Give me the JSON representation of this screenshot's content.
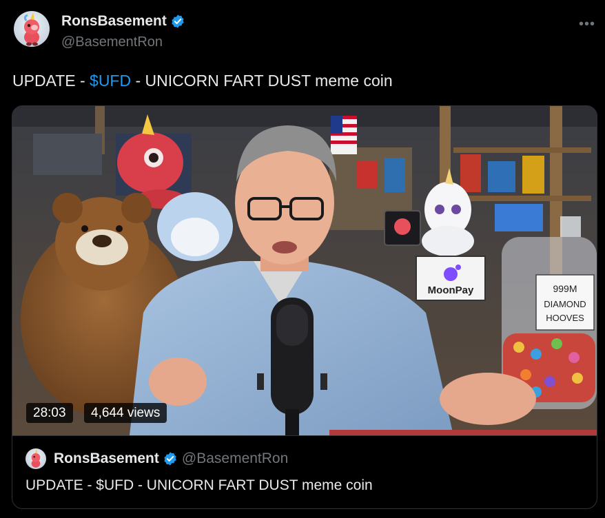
{
  "author": {
    "display_name": "RonsBasement",
    "handle": "@BasementRon",
    "verified": true
  },
  "post": {
    "text_prefix": "UPDATE - ",
    "cashtag": "$UFD",
    "text_suffix": " - UNICORN FART DUST meme coin"
  },
  "video": {
    "duration": "28:03",
    "views": "4,644 views",
    "signs": {
      "moonpay": "MoonPay",
      "jar_line1": "999M",
      "jar_line2": "DIAMOND",
      "jar_line3": "HOOVES"
    }
  },
  "quote": {
    "display_name": "RonsBasement",
    "handle": "@BasementRon",
    "text": "UPDATE - $UFD - UNICORN FART DUST meme coin"
  },
  "icons": {
    "verified": "verified-badge-icon",
    "more": "more-options-icon"
  },
  "colors": {
    "background": "#000000",
    "text": "#e7e9ea",
    "secondary": "#71767b",
    "accent": "#1d9bf0",
    "border": "#2f3336"
  }
}
